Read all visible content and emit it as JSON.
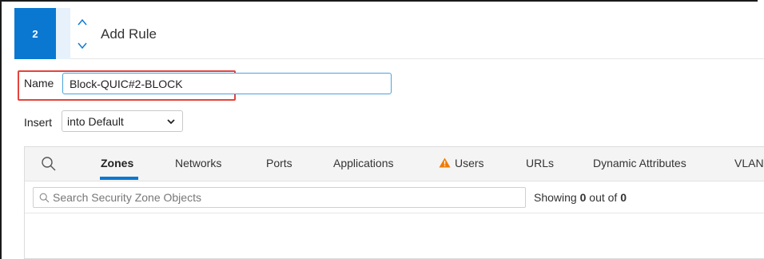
{
  "header": {
    "step_number": "2",
    "title": "Add Rule"
  },
  "form": {
    "name_label": "Name",
    "name_value": "Block-QUIC#2-BLOCK",
    "insert_label": "Insert",
    "insert_value": "into Default"
  },
  "tabs": [
    {
      "label": "Zones",
      "active": true
    },
    {
      "label": "Networks",
      "active": false
    },
    {
      "label": "Ports",
      "active": false
    },
    {
      "label": "Applications",
      "active": false
    },
    {
      "label": "Users",
      "active": false,
      "warning": true
    },
    {
      "label": "URLs",
      "active": false
    },
    {
      "label": "Dynamic Attributes",
      "active": false
    },
    {
      "label": "VLAN",
      "active": false
    }
  ],
  "search": {
    "placeholder": "Search Security Zone Objects"
  },
  "results": {
    "prefix": "Showing ",
    "shown": "0",
    "middle": " out of ",
    "total": "0"
  },
  "colors": {
    "accent": "#0a78d1",
    "highlight": "#e5433b",
    "warning": "#f07b00"
  },
  "icons": {
    "up": "chevron-up-icon",
    "down": "chevron-down-icon",
    "search": "search-icon",
    "warning": "warning-icon",
    "caret": "caret-down-icon"
  }
}
